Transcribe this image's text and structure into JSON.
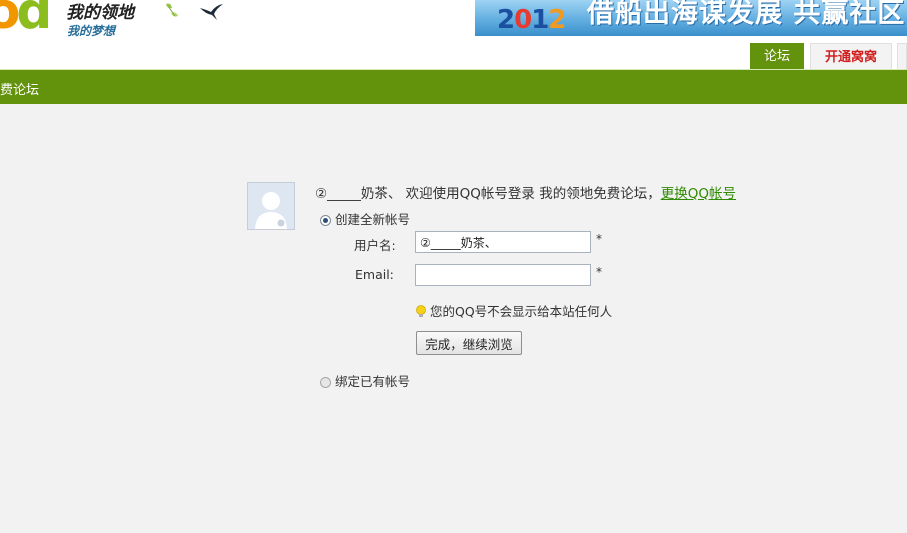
{
  "header": {
    "logo_mark": "od",
    "logo_name": "我的领地",
    "logo_slogan": "我的梦想",
    "banner": {
      "year": [
        "2",
        "0",
        "1",
        "2"
      ],
      "slogan": "借船出海谋发展 共赢社区"
    },
    "tabs": [
      {
        "label": "论坛",
        "active": true
      },
      {
        "label": "开通窝窝",
        "active": false
      }
    ]
  },
  "navbar": {
    "breadcrumb": "费论坛"
  },
  "login": {
    "username_display": "②_____奶茶、",
    "welcome_text": " 欢迎使用QQ帐号登录 我的领地免费论坛，",
    "change_qq_link": "更换QQ帐号",
    "option_create": "创建全新帐号",
    "option_bind": "绑定已有帐号",
    "fields": {
      "username_label": "用户名:",
      "username_value": "②_____奶茶、",
      "email_label": "Email:",
      "email_value": "",
      "required_mark": "*"
    },
    "hint": "您的QQ号不会显示给本站任何人",
    "submit_label": "完成，继续浏览"
  },
  "colors": {
    "nav_green": "#63920d",
    "link_green": "#2f8a00",
    "tab_red": "#d21f1f"
  }
}
